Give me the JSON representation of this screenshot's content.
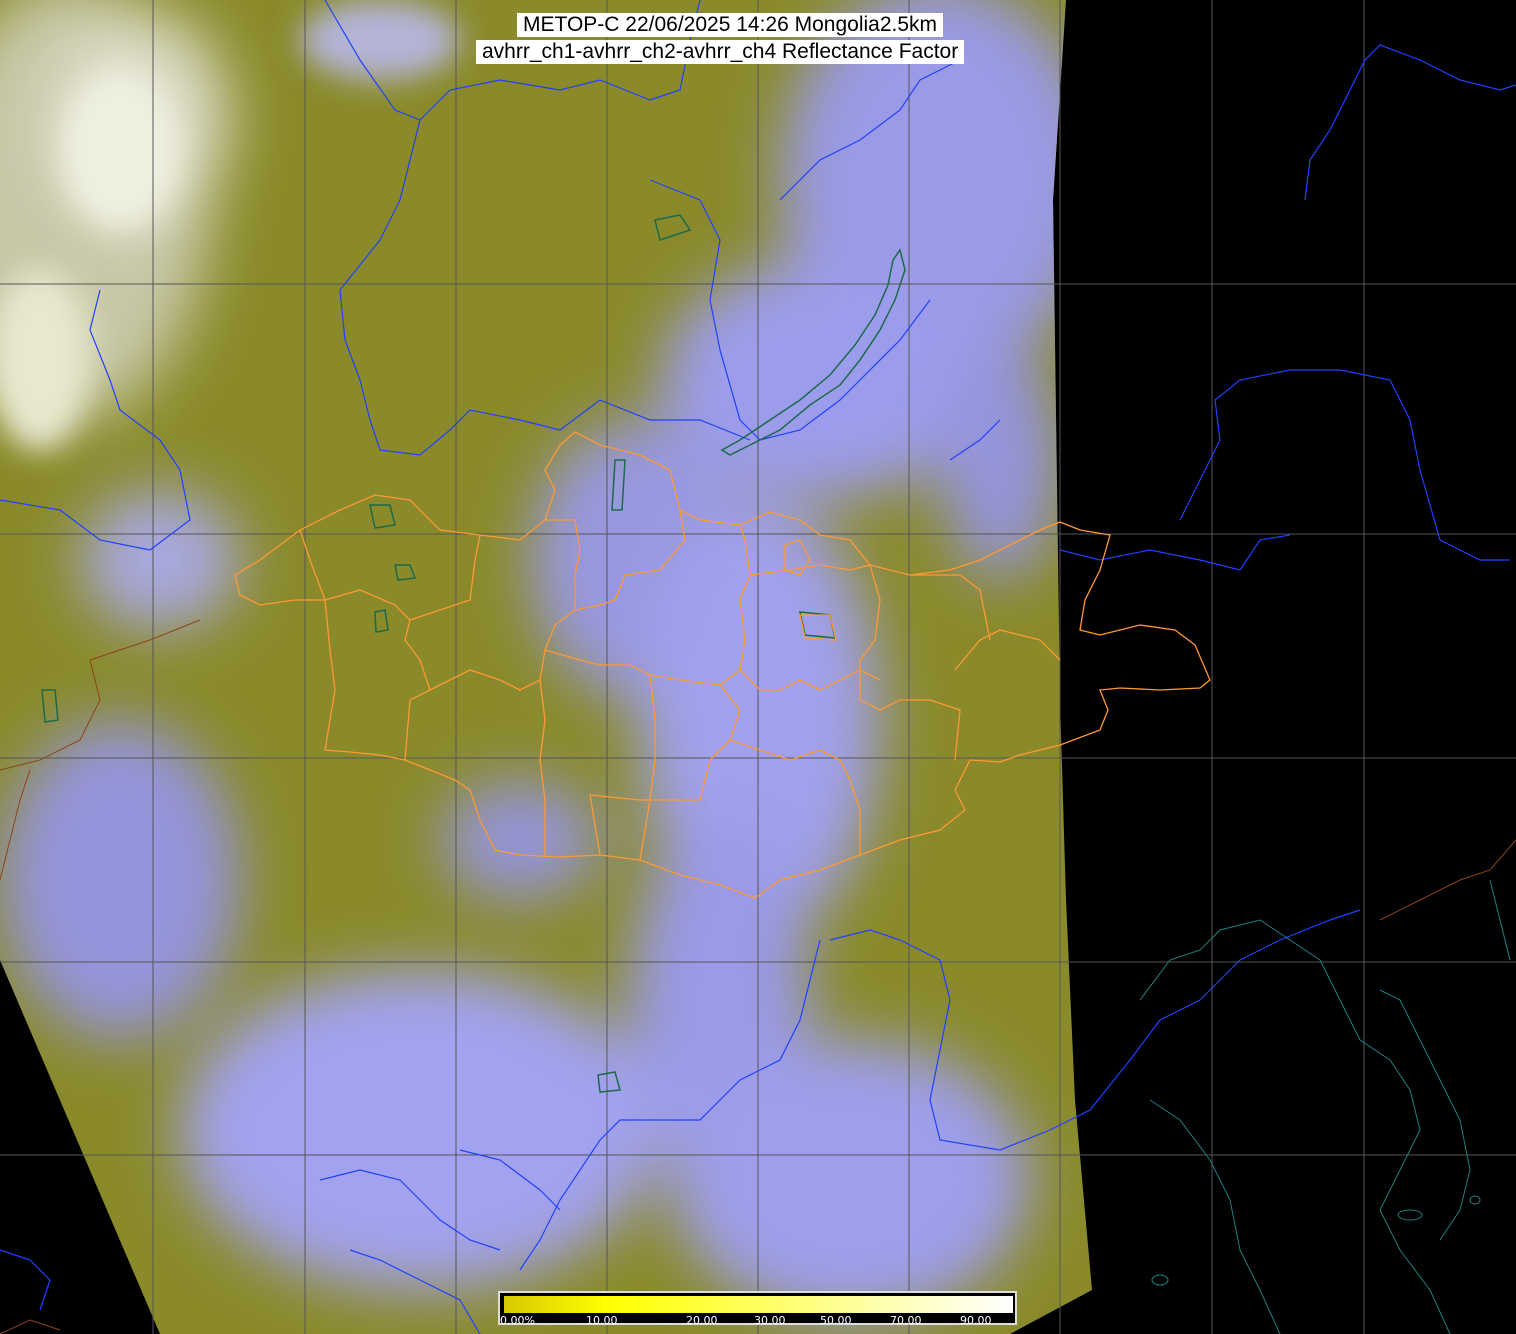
{
  "header": {
    "title_line1": "METOP-C 22/06/2025 14:26 Mongolia2.5km",
    "title_line2": "avhrr_ch1-avhrr_ch2-avhrr_ch4 Reflectance Factor"
  },
  "colorbar": {
    "labels": [
      "0.00%",
      "10.00",
      "20.00",
      "30.00",
      "50.00",
      "70.00",
      "90.00"
    ],
    "colors": [
      "#d8c800",
      "#ffff00",
      "#ffff40",
      "#ffff80",
      "#ffffc0",
      "#ffffff"
    ]
  },
  "colors": {
    "land_olive": "#8a8a26",
    "cloud_lavender": "#a0a0f0",
    "no_data": "#000000",
    "graticule": "#555555",
    "coastline_river": "#2040ff",
    "province_border": "#ff9933",
    "lake": "#1c6a4a"
  }
}
